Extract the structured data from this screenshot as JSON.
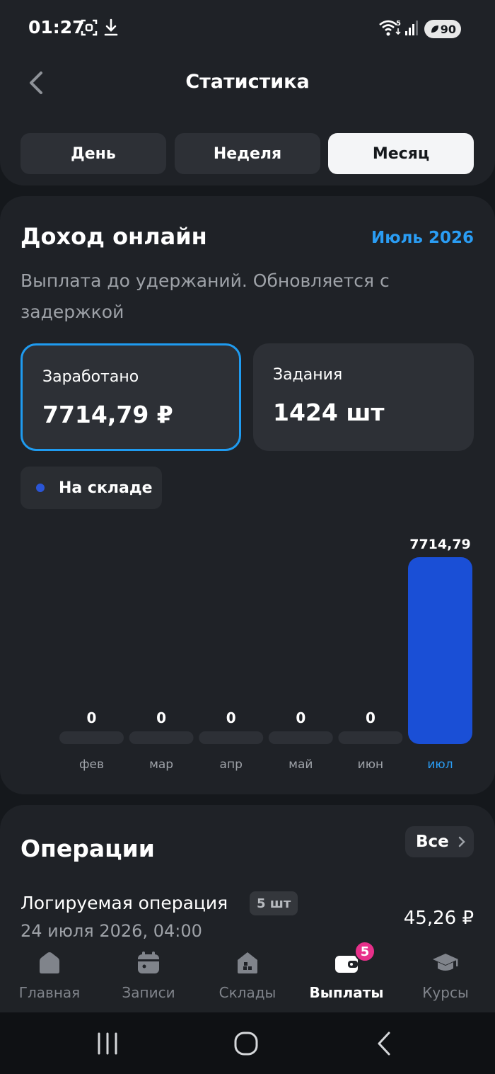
{
  "status_bar": {
    "time": "01:27",
    "battery": "90",
    "wifi_badge": "5",
    "icons": [
      "screenshot-icon",
      "download-icon",
      "wifi-icon",
      "signal-icon",
      "battery-icon"
    ]
  },
  "header": {
    "title": "Статистика",
    "tabs": [
      {
        "label": "День",
        "active": false
      },
      {
        "label": "Неделя",
        "active": false
      },
      {
        "label": "Месяц",
        "active": true
      }
    ]
  },
  "income": {
    "title": "Доход онлайн",
    "period": "Июль 2026",
    "subtitle": "Выплата до удержаний. Обновляется с задержкой",
    "earned_label": "Заработано",
    "earned_value": "7714,79 ₽",
    "tasks_label": "Задания",
    "tasks_value": "1424 шт",
    "legend_label": "На складе"
  },
  "chart_data": {
    "type": "bar",
    "categories": [
      "фев",
      "мар",
      "апр",
      "май",
      "июн",
      "июл"
    ],
    "series": [
      {
        "name": "На складе",
        "values": [
          0,
          0,
          0,
          0,
          0,
          7714.79
        ]
      }
    ],
    "value_labels": [
      "0",
      "0",
      "0",
      "0",
      "0",
      "7714,79"
    ],
    "highlighted_category": "июл",
    "colors": {
      "bar": "#1a4fd6",
      "empty_bar": "#2d3036",
      "highlight_label": "#2a9df4",
      "label": "#9ea2a8"
    }
  },
  "operations": {
    "title": "Операции",
    "all_label": "Все",
    "items": [
      {
        "name": "Логируемая операция",
        "badge": "5 шт",
        "date": "24 июля 2026, 04:00",
        "amount": "45,26 ₽"
      }
    ]
  },
  "bottom_nav": {
    "items": [
      {
        "label": "Главная",
        "icon": "home-icon",
        "active": false
      },
      {
        "label": "Записи",
        "icon": "calendar-icon",
        "active": false
      },
      {
        "label": "Склады",
        "icon": "warehouse-icon",
        "active": false
      },
      {
        "label": "Выплаты",
        "icon": "wallet-icon",
        "active": true
      },
      {
        "label": "Курсы",
        "icon": "graduation-cap-icon",
        "active": false
      }
    ],
    "payouts_badge": "5"
  },
  "colors": {
    "background": "#15181c",
    "card": "#1f2227",
    "accent_blue": "#2a9df4",
    "bar_blue": "#1a4fd6",
    "badge_pink": "#e8308a"
  }
}
